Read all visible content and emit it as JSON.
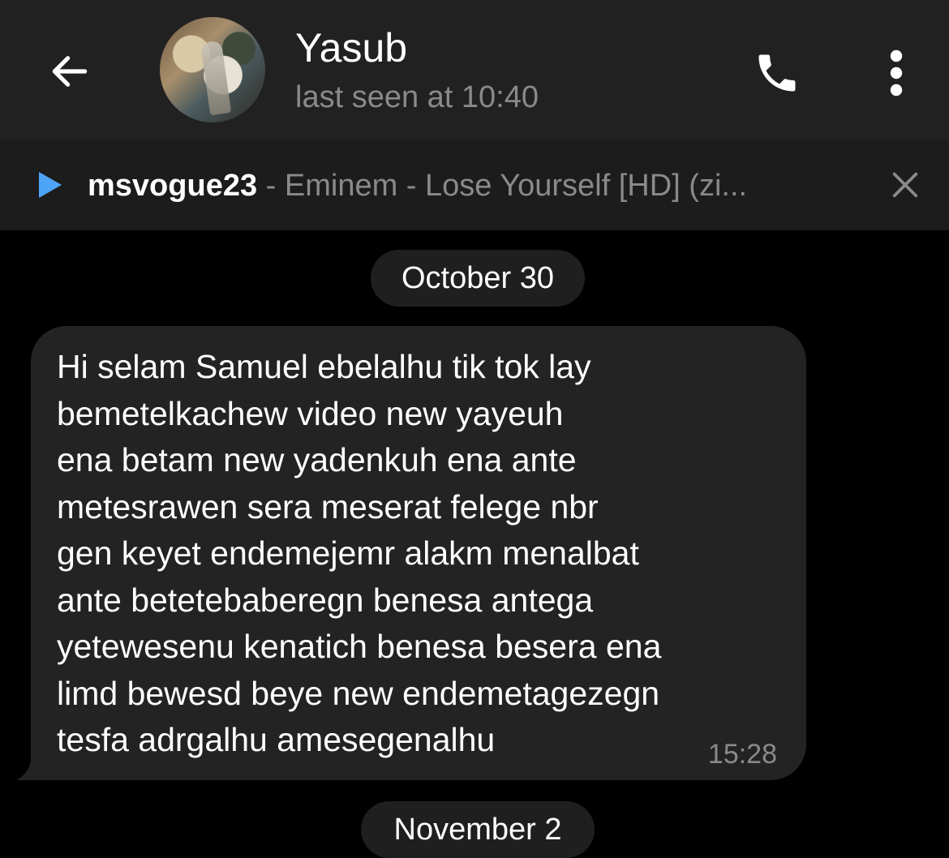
{
  "header": {
    "contact_name": "Yasub",
    "last_seen": "last seen at 10:40",
    "back_icon": "arrow-left-icon",
    "call_icon": "phone-icon",
    "menu_icon": "more-vertical-icon"
  },
  "player": {
    "user": "msvogue23",
    "separator": " - ",
    "track": "Eminem - Lose Yourself [HD] (zi...",
    "play_icon": "play-icon",
    "close_icon": "close-icon",
    "accent_color": "#4ea4f6"
  },
  "chat": {
    "date_separators": [
      "October 30",
      "November 2"
    ],
    "messages": [
      {
        "text": "Hi selam Samuel ebelalhu tik tok lay\nbemetelkachew video new yayeuh\nena betam new yadenkuh ena ante\nmetesrawen sera meserat felege nbr\ngen keyet endemejemr alakm menalbat\nante betetebaberegn benesa antega\nyetewesenu kenatich benesa besera ena\nlimd bewesd beye new endemetagezegn\ntesfa adrgalhu amesegenalhu",
        "time": "15:28"
      }
    ]
  }
}
